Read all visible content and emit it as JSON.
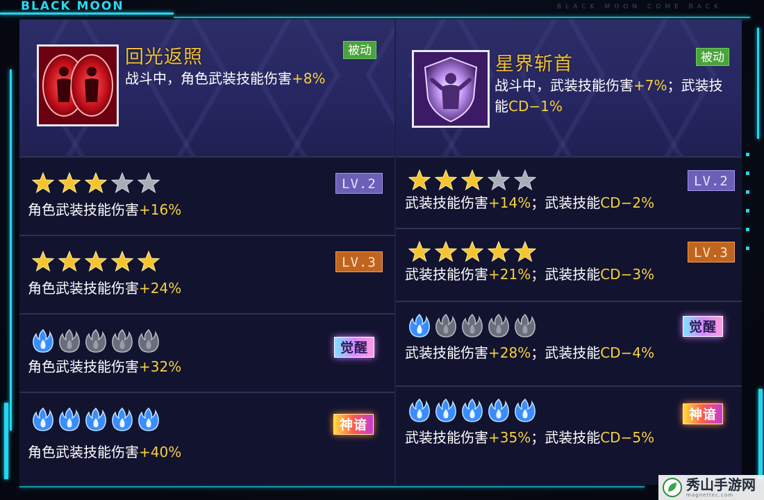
{
  "brand": {
    "left": "BLACK MOON",
    "right": "BLACK MOON COME BACK"
  },
  "colors": {
    "accent": "#23d6f0",
    "highlight": "#f7d23e",
    "title": "#f1c23a",
    "passive": "#4aa33b"
  },
  "skills": [
    {
      "name": "回光返照",
      "tag": "被动",
      "icon": "red-twin-figures-icon",
      "desc_prefix": "战斗中，角色武装技能伤害",
      "desc_value": "+8%",
      "desc_sep": "",
      "desc_suffix": "",
      "desc_value2": "",
      "tiers": [
        {
          "mark_type": "star",
          "filled": 3,
          "total": 5,
          "badge": "LV.2",
          "text_a": "角色武装技能伤害",
          "val_a": "+16%",
          "text_b": "",
          "val_b": ""
        },
        {
          "mark_type": "star",
          "filled": 5,
          "total": 5,
          "badge": "LV.3",
          "text_a": "角色武装技能伤害",
          "val_a": "+24%",
          "text_b": "",
          "val_b": ""
        },
        {
          "mark_type": "flame",
          "filled": 1,
          "total": 5,
          "badge": "觉醒",
          "text_a": "角色武装技能伤害",
          "val_a": "+32%",
          "text_b": "",
          "val_b": ""
        },
        {
          "mark_type": "flame",
          "filled": 5,
          "total": 5,
          "badge": "神谙",
          "text_a": "角色武装技能伤害",
          "val_a": "+40%",
          "text_b": "",
          "val_b": ""
        }
      ]
    },
    {
      "name": "星界斩首",
      "tag": "被动",
      "icon": "purple-shield-figure-icon",
      "desc_prefix": "战斗中，武装技能伤害",
      "desc_value": "+7%",
      "desc_sep": "；武装技能",
      "desc_suffix": "",
      "desc_value2": "CD−1%",
      "tiers": [
        {
          "mark_type": "star",
          "filled": 3,
          "total": 5,
          "badge": "LV.2",
          "text_a": "武装技能伤害",
          "val_a": "+14%",
          "text_b": "；武装技能",
          "val_b": "CD−2%"
        },
        {
          "mark_type": "star",
          "filled": 5,
          "total": 5,
          "badge": "LV.3",
          "text_a": "武装技能伤害",
          "val_a": "+21%",
          "text_b": "；武装技能",
          "val_b": "CD−3%"
        },
        {
          "mark_type": "flame",
          "filled": 1,
          "total": 5,
          "badge": "觉醒",
          "text_a": "武装技能伤害",
          "val_a": "+28%",
          "text_b": "；武装技能",
          "val_b": "CD−4%"
        },
        {
          "mark_type": "flame",
          "filled": 5,
          "total": 5,
          "badge": "神谙",
          "text_a": "武装技能伤害",
          "val_a": "+35%",
          "text_b": "；武装技能",
          "val_b": "CD−5%"
        }
      ]
    }
  ],
  "watermark": {
    "name": "秀山手游网",
    "url": "magnettec.com"
  }
}
